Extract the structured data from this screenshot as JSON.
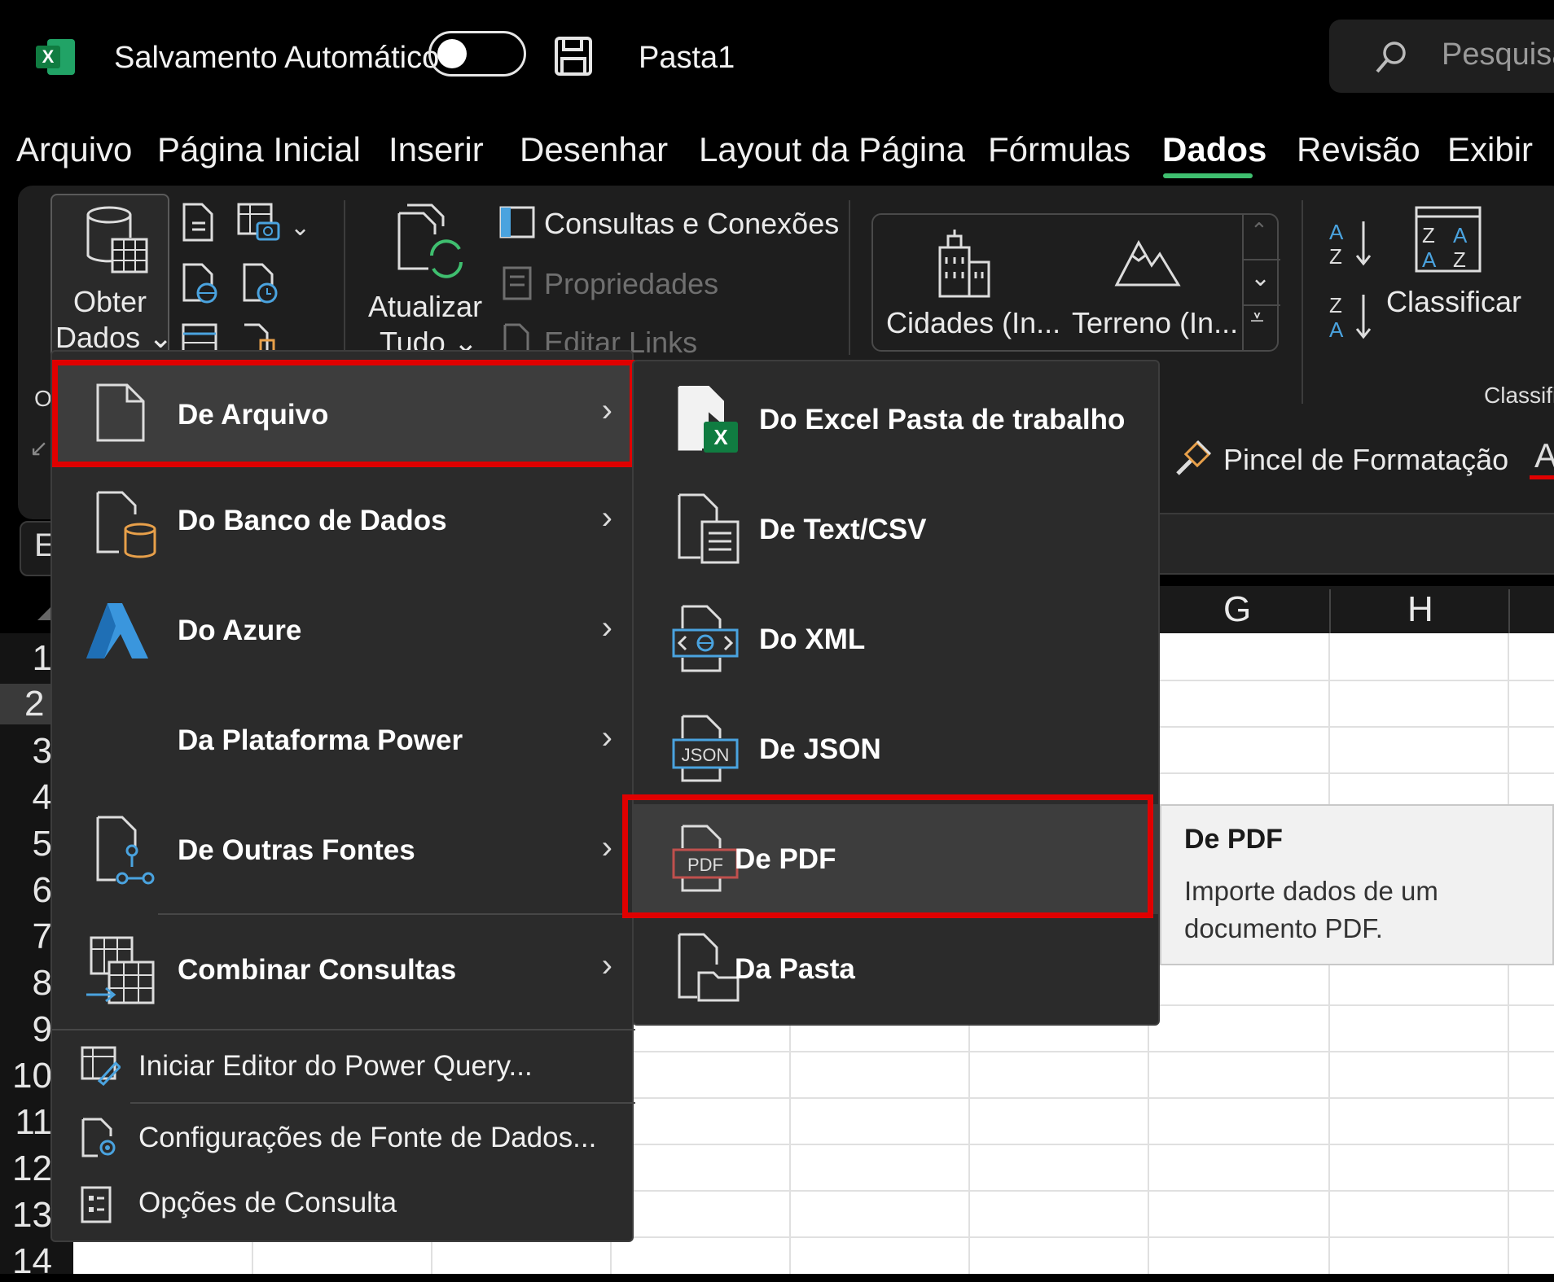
{
  "titlebar": {
    "autosave_label": "Salvamento Automático",
    "file_name": "Pasta1",
    "search_placeholder": "Pesquisa"
  },
  "menubar": {
    "tabs": [
      "Arquivo",
      "Página Inicial",
      "Inserir",
      "Desenhar",
      "Layout da Página",
      "Fórmulas",
      "Dados",
      "Revisão",
      "Exibir"
    ],
    "active_tab": "Dados"
  },
  "ribbon": {
    "get_data": [
      "Obter",
      "Dados ⌄"
    ],
    "refresh_all": [
      "Atualizar",
      "Tudo ⌄"
    ],
    "queries_connections": "Consultas e Conexões",
    "properties": "Propriedades",
    "edit_links": "Editar Links",
    "gallery": [
      "Cidades (In...",
      "Terreno (In..."
    ],
    "sort": "Classificar",
    "sort_group_label": "Classifi",
    "group_label_left": "O",
    "format_painter": "Pincel de Formatação",
    "right_edge_letter": "A"
  },
  "sheet": {
    "name_box": "E",
    "columns": [
      "G",
      "H"
    ],
    "rows": [
      "1",
      "2",
      "3",
      "4",
      "5",
      "6",
      "7",
      "8",
      "9",
      "10",
      "11",
      "12",
      "13",
      "14"
    ],
    "selected_row": "2"
  },
  "menu_obter_dados": {
    "items": [
      {
        "label": "De Arquivo",
        "has_submenu": true
      },
      {
        "label": "Do Banco de Dados",
        "has_submenu": true
      },
      {
        "label": "Do Azure",
        "has_submenu": true
      },
      {
        "label": "Da Plataforma Power",
        "has_submenu": true
      },
      {
        "label": "De Outras Fontes",
        "has_submenu": true
      },
      {
        "label": "Combinar Consultas",
        "has_submenu": true
      }
    ],
    "commands": [
      "Iniciar Editor do Power Query...",
      "Configurações de Fonte de Dados...",
      "Opções de Consulta"
    ],
    "chevron": "›"
  },
  "submenu_de_arquivo": {
    "items": [
      "Do Excel Pasta de trabalho",
      "De Text/CSV",
      "Do XML",
      "De JSON",
      "De PDF",
      "Da Pasta"
    ]
  },
  "icons": {
    "json_label": "JSON",
    "pdf_label": "PDF",
    "excel_label": "X"
  },
  "tooltip": {
    "title": "De PDF",
    "body": "Importe dados de um documento PDF."
  },
  "colors": {
    "accent_green": "#3fbf6f",
    "highlight_red": "#e00000",
    "azure_blue": "#3a96dd",
    "excel_green": "#107c41",
    "pdf_red": "#c0504d",
    "db_orange": "#e8a04a"
  }
}
